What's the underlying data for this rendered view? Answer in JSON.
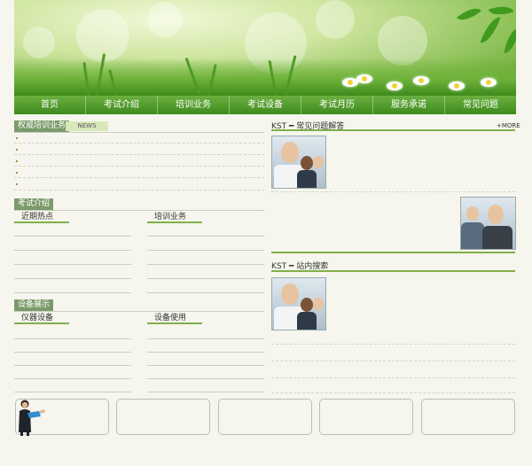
{
  "nav": {
    "items": [
      "首页",
      "考试介绍",
      "培训业务",
      "考试设备",
      "考试月历",
      "服务承诺",
      "常见问题"
    ]
  },
  "left": {
    "authority_title": "权威培训业务",
    "news_tab": "NEWS",
    "exam_title": "考试介绍",
    "exam_sub_left": "近期热点",
    "exam_sub_right": "培训业务",
    "equip_title": "设备展示",
    "equip_sub_left": "仪器设备",
    "equip_sub_right": "设备使用"
  },
  "right": {
    "faq_prefix": "KST",
    "faq_title": "常见问题解答",
    "more": "+MORE",
    "search_prefix": "KST",
    "search_title": "站内搜索"
  },
  "colors": {
    "nav": "#4e9a2a",
    "accent": "#7fb04a",
    "section": "#7a9a6a"
  }
}
